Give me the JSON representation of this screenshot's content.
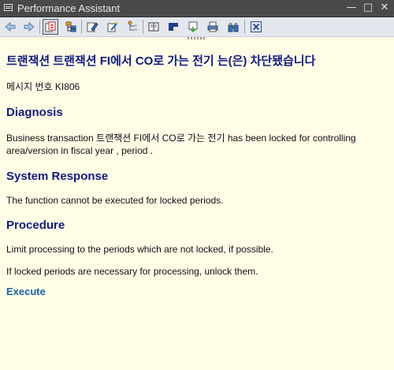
{
  "window": {
    "title": "Performance Assistant",
    "controls": {
      "minimize": "—",
      "maximize": "□",
      "close": "✕"
    }
  },
  "toolbar": {
    "buttons": [
      {
        "name": "back-button",
        "icon": "arrow-left-icon"
      },
      {
        "name": "forward-button",
        "icon": "arrow-right-icon"
      },
      {
        "name": "technical-info-button",
        "icon": "technical-info-icon"
      },
      {
        "name": "structure-button",
        "icon": "structure-icon"
      },
      {
        "name": "edit-button",
        "icon": "pencil-icon"
      },
      {
        "name": "enhance-button",
        "icon": "magic-wand-icon"
      },
      {
        "name": "tree-button",
        "icon": "tree-icon"
      },
      {
        "name": "book-button",
        "icon": "book-icon"
      },
      {
        "name": "bookmark-button",
        "icon": "bookmark-icon"
      },
      {
        "name": "export-button",
        "icon": "export-icon"
      },
      {
        "name": "print-button",
        "icon": "printer-icon"
      },
      {
        "name": "find-button",
        "icon": "binoculars-icon"
      },
      {
        "name": "close-window-button",
        "icon": "close-box-icon"
      }
    ]
  },
  "doc": {
    "title": "트랜잭션 트랜잭션 FI에서 CO로 가는 전기 는(은) 차단됐습니다",
    "message_number": "메시지 번호 KI806",
    "diagnosis_heading": "Diagnosis",
    "diagnosis_text": "Business transaction 트랜잭션 FI에서 CO로 가는 전기 has been locked for controlling area/version  in fiscal year , period .",
    "system_response_heading": "System Response",
    "system_response_text": "The function cannot be executed for locked periods.",
    "procedure_heading": "Procedure",
    "procedure_text_1": "Limit processing to the periods which are not locked, if possible.",
    "procedure_text_2": "If locked periods are necessary for processing, unlock them.",
    "execute_link": "Execute"
  }
}
